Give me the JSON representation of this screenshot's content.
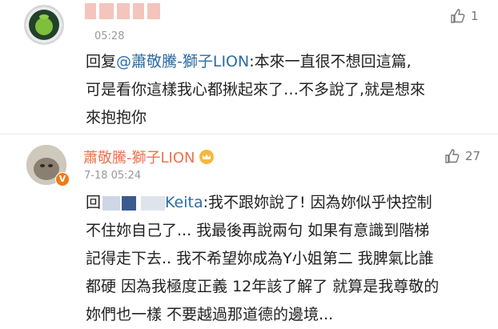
{
  "comments": [
    {
      "time": "05:28",
      "likes": "1",
      "lines": [
        {
          "reply_prefix": "回复",
          "mention": "@蕭敬騰-獅子LION",
          "text": ":本來一直很不想回這篇,"
        },
        {
          "text": "可是看你這樣我心都揪起來了…不多說了,就是想來"
        },
        {
          "text": "來抱抱你"
        }
      ]
    },
    {
      "author": "蕭敬騰-獅子LION",
      "time": "7-18 05:24",
      "likes": "27",
      "badge": "V",
      "lines": [
        {
          "reply_prefix": "回",
          "mention_tail": "Keita",
          "text": ":我不跟妳說了! 因為妳似乎快控制"
        },
        {
          "text": "不住妳自己了... 我最後再說兩句 如果有意識到階梯"
        },
        {
          "text": "記得走下去.. 我不希望妳成為Y小姐第二 我脾氣比誰"
        },
        {
          "text": "都硬 因為我極度正義 12年該了解了 就算是我尊敬的"
        },
        {
          "text": "妳們也一樣 不要越過那道德的邊境..."
        }
      ]
    }
  ],
  "colors": {
    "author": "#eb7350",
    "mention": "#2e6ca4",
    "badge": "#ee7b12",
    "time": "#999999"
  },
  "icons": {
    "like": "thumbs-up-icon",
    "crown": "crown-icon",
    "verified": "verified-badge-icon"
  }
}
